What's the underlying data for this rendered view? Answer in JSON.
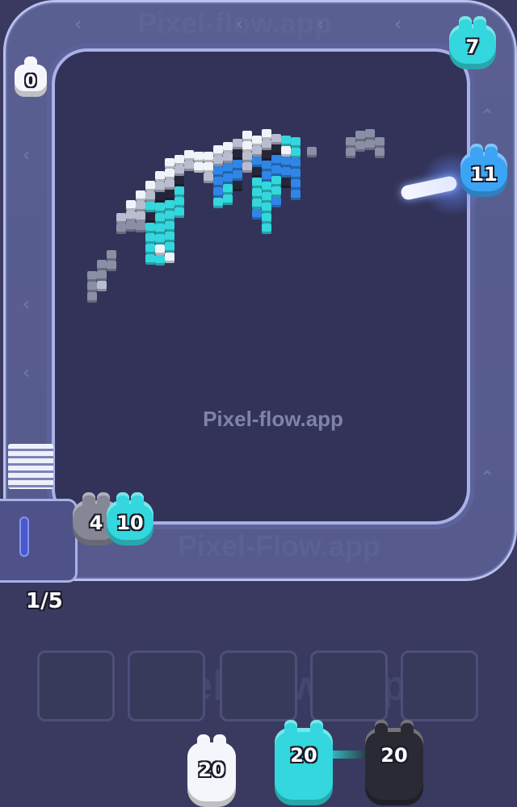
{
  "watermark": "Pixel-flow.app",
  "track_watermark": "Pixel-Flow.app",
  "progress": {
    "label": "1/5"
  },
  "shooters_on_track": [
    {
      "value": "0",
      "color": "white"
    },
    {
      "value": "7",
      "color": "cyan"
    },
    {
      "value": "11",
      "color": "blue"
    }
  ],
  "queue_on_track": [
    {
      "value": "4",
      "color": "gray"
    },
    {
      "value": "10",
      "color": "cyan"
    }
  ],
  "bench_slots": {
    "count": 5,
    "filled": 0
  },
  "reserve_shooters": [
    {
      "value": "20",
      "color": "white"
    },
    {
      "value": "20",
      "color": "cyan"
    },
    {
      "value": "20",
      "color": "black"
    }
  ],
  "colors": {
    "cyan": "#33d7dd",
    "blue": "#3ca4f4",
    "white": "#f4f6fb",
    "black": "#2a2a35",
    "gray": "#868796",
    "board": "#33335a",
    "track": "#565a8c"
  }
}
